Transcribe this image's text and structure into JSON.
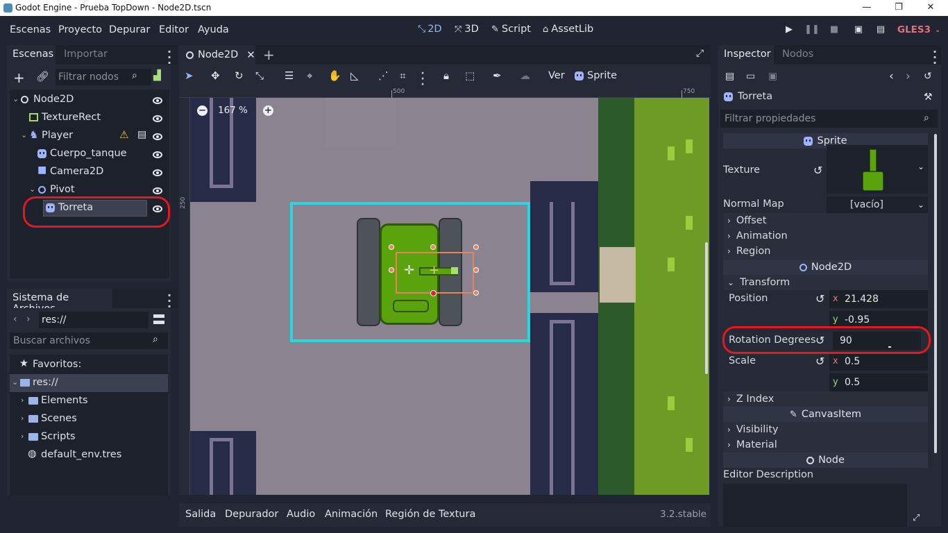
{
  "window": {
    "title": "Godot Engine - Prueba TopDown - Node2D.tscn",
    "controls": [
      "—",
      "❐",
      "✕"
    ]
  },
  "menu": {
    "items": [
      "Escenas",
      "Proyecto",
      "Depurar",
      "Editor",
      "Ayuda"
    ],
    "workspaces": [
      "2D",
      "3D",
      "Script",
      "AssetLib"
    ],
    "renderer": "GLES3"
  },
  "scene_dock": {
    "tabs": [
      "Escenas",
      "Importar"
    ],
    "filter_placeholder": "Filtrar nodos",
    "tree": [
      {
        "label": "Node2D",
        "icon": "node-circle-icon"
      },
      {
        "label": "TextureRect",
        "icon": "texture-rect-icon"
      },
      {
        "label": "Player",
        "icon": "kinematic-body-icon"
      },
      {
        "label": "Cuerpo_tanque",
        "icon": "sprite-icon"
      },
      {
        "label": "Camera2D",
        "icon": "camera-icon"
      },
      {
        "label": "Pivot",
        "icon": "node-circle-icon"
      },
      {
        "label": "Torreta",
        "icon": "sprite-icon"
      }
    ]
  },
  "filesystem": {
    "title": "Sistema de Archivos",
    "path": "res://",
    "search_placeholder": "Buscar archivos",
    "items": [
      "Favoritos:",
      "res://",
      "Elements",
      "Scenes",
      "Scripts",
      "default_env.tres"
    ]
  },
  "editor": {
    "scene_tab": "Node2D",
    "view_label": "Ver",
    "sprite_label": "Sprite",
    "zoom": "167 %",
    "ruler_marks": [
      "500",
      "750",
      "250"
    ],
    "bottom_tabs": [
      "Salida",
      "Depurador",
      "Audio",
      "Animación",
      "Región de Textura"
    ],
    "version": "3.2.stable"
  },
  "inspector": {
    "tabs": [
      "Inspector",
      "Nodos"
    ],
    "object_name": "Torreta",
    "filter_placeholder": "Filtrar propiedades",
    "sections": {
      "sprite": "Sprite",
      "node2d": "Node2D",
      "canvasitem": "CanvasItem",
      "node": "Node"
    },
    "props": {
      "texture": "Texture",
      "normal_map": "Normal Map",
      "normal_map_value": "[vacío]",
      "offset": "Offset",
      "animation": "Animation",
      "region": "Region",
      "transform": "Transform",
      "position": "Position",
      "position_x": "21.428",
      "position_y": "-0.95",
      "rotation": "Rotation Degrees",
      "rotation_value": "90",
      "scale": "Scale",
      "scale_x": "0.5",
      "scale_y": "0.5",
      "z_index": "Z Index",
      "visibility": "Visibility",
      "material": "Material",
      "editor_description": "Editor Description",
      "axis_x": "x",
      "axis_y": "y"
    }
  },
  "colors": {
    "accent": "#8eb8f6",
    "selection_box": "#25d8df",
    "highlight_ring": "#e8161f",
    "renderer": "#e36f7b",
    "tank_green": "#5aa30c"
  }
}
